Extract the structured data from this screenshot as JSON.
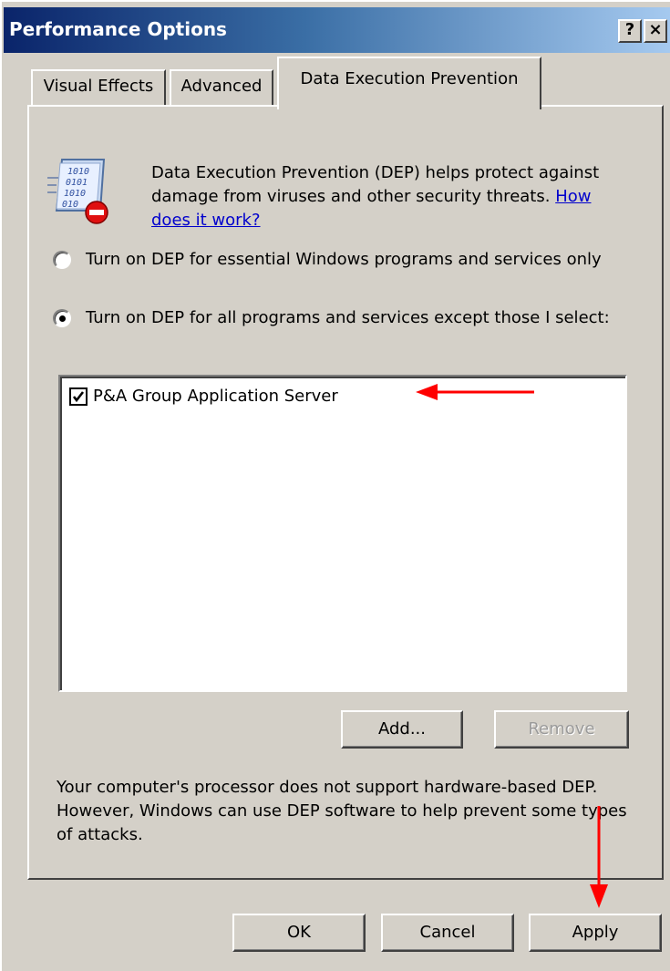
{
  "window": {
    "title": "Performance Options",
    "help_button": "?",
    "close_button": "×"
  },
  "tabs": [
    {
      "label": "Visual Effects",
      "active": false
    },
    {
      "label": "Advanced",
      "active": false
    },
    {
      "label": "Data Execution Prevention",
      "active": true
    }
  ],
  "dep": {
    "icon": "dep-shield-icon",
    "description": "Data Execution Prevention (DEP) helps protect against damage from viruses and other security threats.",
    "help_link": "How does it work?",
    "options": [
      {
        "label": "Turn on DEP for essential Windows programs and services only",
        "selected": false
      },
      {
        "label": "Turn on DEP for all programs and services except those I select:",
        "selected": true
      }
    ],
    "exceptions": [
      {
        "label": "P&A Group Application Server",
        "checked": true
      }
    ],
    "add_button": "Add...",
    "remove_button": "Remove",
    "note": "Your computer's processor does not support hardware-based DEP. However, Windows can use DEP software to help prevent some types of attacks."
  },
  "footer": {
    "ok": "OK",
    "cancel": "Cancel",
    "apply": "Apply"
  },
  "annotations": {
    "arrow_color": "#ff0000"
  }
}
